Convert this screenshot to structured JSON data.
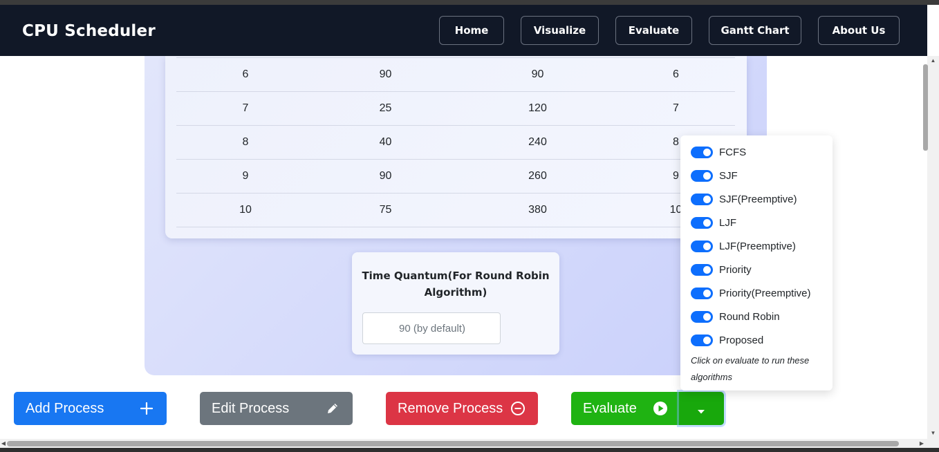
{
  "navbar": {
    "brand": "CPU Scheduler",
    "links": [
      {
        "label": "Home"
      },
      {
        "label": "Visualize"
      },
      {
        "label": "Evaluate"
      },
      {
        "label": "Gantt Chart"
      },
      {
        "label": "About Us"
      }
    ]
  },
  "process_table": {
    "rows": [
      [
        "6",
        "90",
        "90",
        "6"
      ],
      [
        "7",
        "25",
        "120",
        "7"
      ],
      [
        "8",
        "40",
        "240",
        "8"
      ],
      [
        "9",
        "90",
        "260",
        "9"
      ],
      [
        "10",
        "75",
        "380",
        "10"
      ]
    ]
  },
  "time_quantum": {
    "title_line1": "Time Quantum(For Round Robin",
    "title_line2": "Algorithm)",
    "placeholder": "90 (by default)"
  },
  "algorithm_dropdown": {
    "items": [
      {
        "label": "FCFS",
        "enabled": true
      },
      {
        "label": "SJF",
        "enabled": true
      },
      {
        "label": "SJF(Preemptive)",
        "enabled": true
      },
      {
        "label": "LJF",
        "enabled": true
      },
      {
        "label": "LJF(Preemptive)",
        "enabled": true
      },
      {
        "label": "Priority",
        "enabled": true
      },
      {
        "label": "Priority(Preemptive)",
        "enabled": true
      },
      {
        "label": "Round Robin",
        "enabled": true
      },
      {
        "label": "Proposed",
        "enabled": true
      }
    ],
    "note_line1": "Click on evaluate to run these",
    "note_line2": "algorithms"
  },
  "actions": {
    "add": {
      "label": "Add Process",
      "icon": "plus-icon",
      "color": "#1877f2"
    },
    "edit": {
      "label": "Edit Process",
      "icon": "pencil-icon",
      "color": "#6c757d"
    },
    "remove": {
      "label": "Remove Process",
      "icon": "minus-circle-icon",
      "color": "#dc3545"
    },
    "evaluate": {
      "label": "Evaluate",
      "icon": "play-circle-icon",
      "color": "#1fb312"
    }
  },
  "colors": {
    "navbar_bg": "#111827",
    "toggle_on": "#0d6efd",
    "panel_bg": "#d4daf9"
  }
}
